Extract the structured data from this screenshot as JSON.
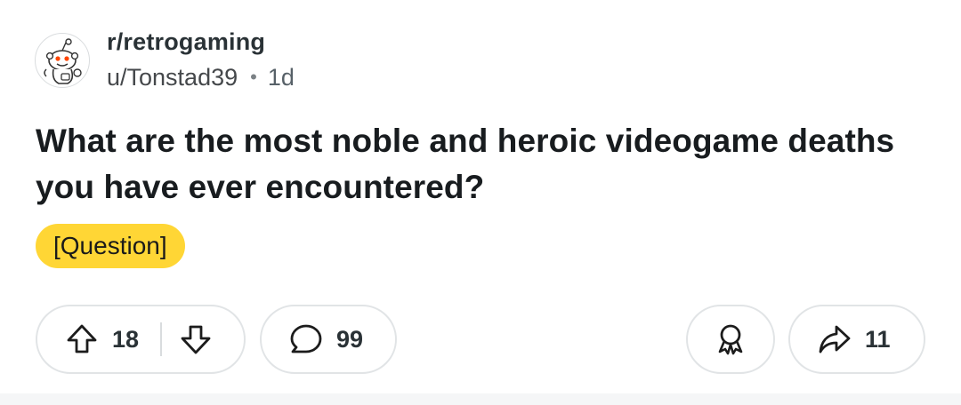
{
  "post": {
    "subreddit": "r/retrogaming",
    "author": "u/Tonstad39",
    "separator": "•",
    "age": "1d",
    "title": "What are the most noble and heroic videogame deaths you have ever encountered?",
    "flair": "[Question]"
  },
  "actions": {
    "upvotes": "18",
    "comments": "99",
    "shares": "11"
  },
  "icons": {
    "avatar": "subreddit-snoo-avatar",
    "upvote": "upvote-arrow-icon",
    "downvote": "downvote-arrow-icon",
    "comment": "comment-bubble-icon",
    "award": "award-ribbon-icon",
    "share": "share-arrow-icon"
  },
  "colors": {
    "flair_background": "#ffd635",
    "pill_border": "#e1e4e6",
    "title_text": "#181c1f"
  }
}
